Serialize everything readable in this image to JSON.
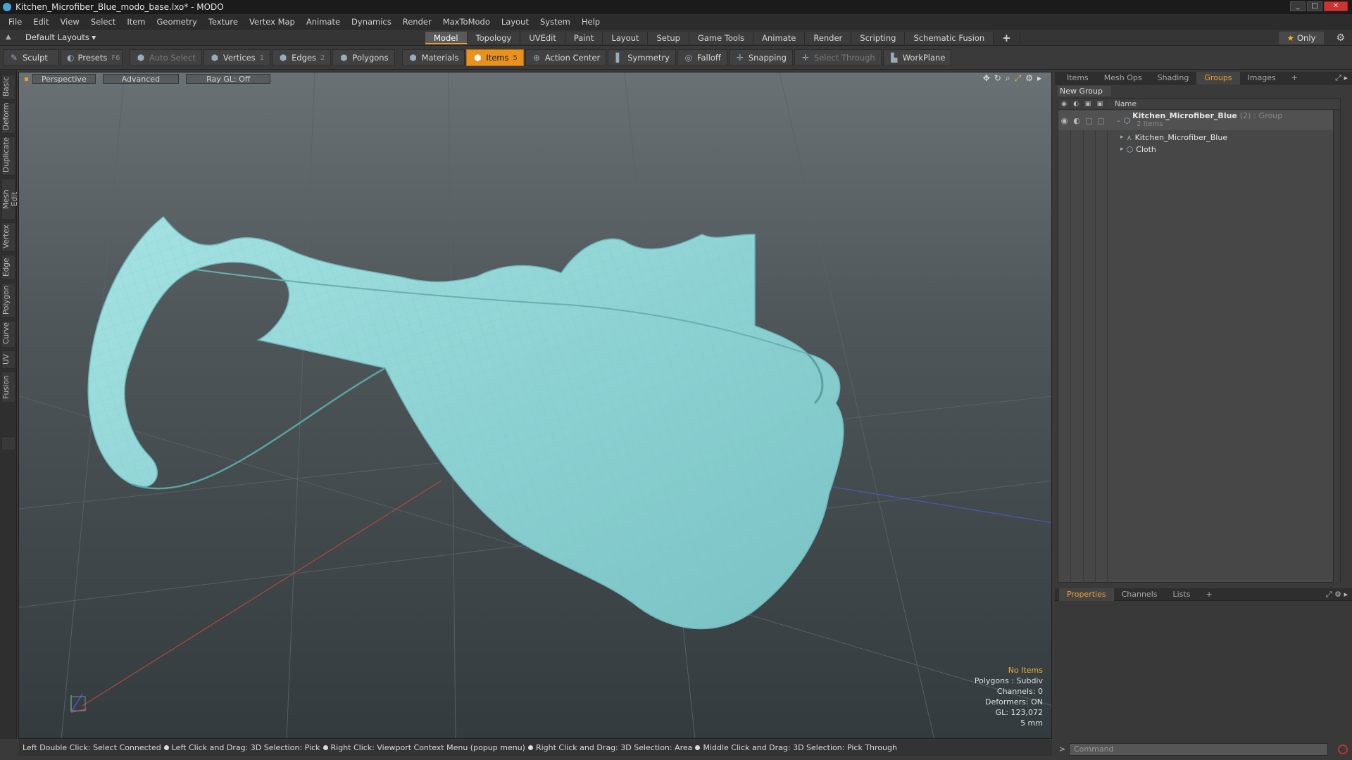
{
  "window": {
    "title": "Kitchen_Microfiber_Blue_modo_base.lxo* - MODO",
    "min_label": "_",
    "max_label": "□",
    "close_label": "✕"
  },
  "menubar": {
    "items": [
      "File",
      "Edit",
      "View",
      "Select",
      "Item",
      "Geometry",
      "Texture",
      "Vertex Map",
      "Animate",
      "Dynamics",
      "Render",
      "MaxToModo",
      "Layout",
      "System",
      "Help"
    ]
  },
  "layoutbar": {
    "layouts_label": "Default Layouts ▾",
    "tabs": [
      "Model",
      "Topology",
      "UVEdit",
      "Paint",
      "Layout",
      "Setup",
      "Game Tools",
      "Animate",
      "Render",
      "Scripting",
      "Schematic Fusion"
    ],
    "active_tab": "Model",
    "add_label": "+",
    "only_label": "Only"
  },
  "toolbar": {
    "sculpt": "Sculpt",
    "presets": "Presets",
    "presets_key": "F6",
    "auto_select": "Auto Select",
    "vertices": "Vertices",
    "vertices_count": "1",
    "edges": "Edges",
    "edges_count": "2",
    "polygons": "Polygons",
    "materials": "Materials",
    "items": "Items",
    "items_count": "5",
    "action_center": "Action Center",
    "symmetry": "Symmetry",
    "falloff": "Falloff",
    "snapping": "Snapping",
    "select_through": "Select Through",
    "workplane": "WorkPlane"
  },
  "left_tabs": [
    "Basic",
    "Deform",
    "Duplicate",
    "Mesh Edit",
    "Vertex",
    "Edge",
    "Polygon",
    "Curve",
    "UV",
    "Fusion"
  ],
  "viewport": {
    "view_mode": "Perspective",
    "shading": "Advanced",
    "raygl": "Ray GL: Off",
    "info": {
      "selection": "No Items",
      "polygons": "Polygons : Subdiv",
      "channels": "Channels: 0",
      "deformers": "Deformers: ON",
      "gl": "GL: 123,072",
      "scale": "5 mm"
    },
    "cloth_color": "#8fd4d4",
    "accent": "#f0b030"
  },
  "statusbar": {
    "hints": [
      "Left Double Click: Select Connected",
      "Left Click and Drag: 3D Selection: Pick",
      "Right Click: Viewport Context Menu (popup menu)",
      "Right Click and Drag: 3D Selection: Area",
      "Middle Click and Drag: 3D Selection: Pick Through"
    ]
  },
  "right_panel": {
    "tabs": [
      "Items",
      "Mesh Ops",
      "Shading",
      "Groups",
      "Images"
    ],
    "active_tab": "Groups",
    "add_label": "+",
    "new_group": "New Group",
    "column_name": "Name",
    "tree": {
      "group_name": "Kitchen_Microfiber_Blue",
      "group_count": "(2)",
      "group_type": ": Group",
      "group_sub": "2 Items",
      "children": [
        "Kitchen_Microfiber_Blue",
        "Cloth"
      ]
    },
    "bottom_tabs": [
      "Properties",
      "Channels",
      "Lists"
    ],
    "bottom_active": "Properties",
    "command_placeholder": "Command"
  }
}
